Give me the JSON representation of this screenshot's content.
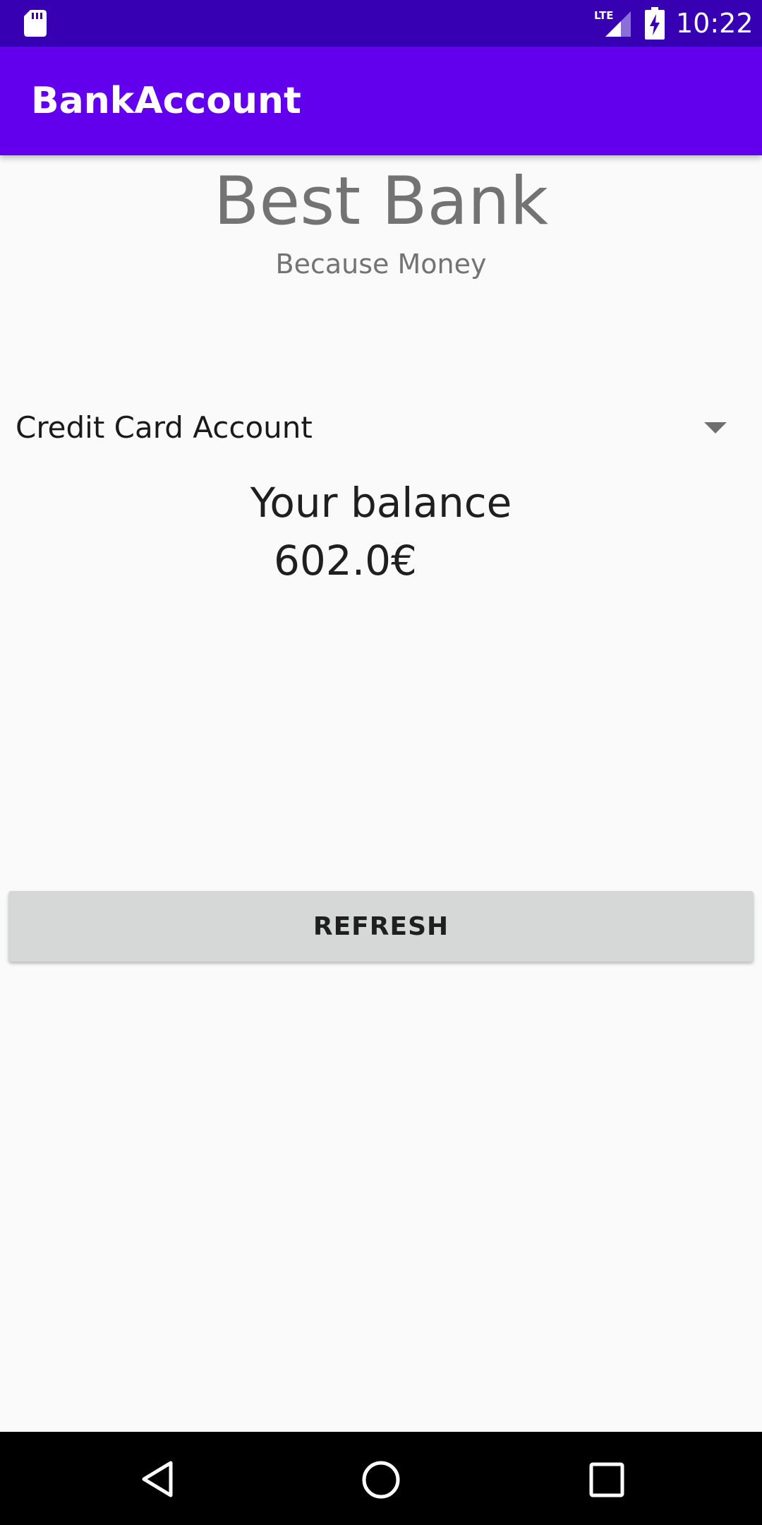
{
  "status_bar": {
    "time": "10:22",
    "network_label": "LTE",
    "icons": [
      "sd-card-icon",
      "lte-signal-icon",
      "battery-charging-icon"
    ]
  },
  "app_bar": {
    "title": "BankAccount"
  },
  "bank": {
    "name": "Best Bank",
    "slogan": "Because Money"
  },
  "account_spinner": {
    "selected": "Credit Card Account",
    "icon": "dropdown-arrow-icon"
  },
  "balance": {
    "label": "Your balance",
    "value": "602.0€"
  },
  "refresh_button": {
    "label": "REFRESH"
  },
  "nav_bar": {
    "icons": [
      "back-icon",
      "home-icon",
      "recents-icon"
    ]
  },
  "colors": {
    "status_bar": "#3700b3",
    "app_bar": "#6200ee",
    "background": "#fafafa",
    "button": "#d6d7d7",
    "muted_text": "#737373"
  }
}
